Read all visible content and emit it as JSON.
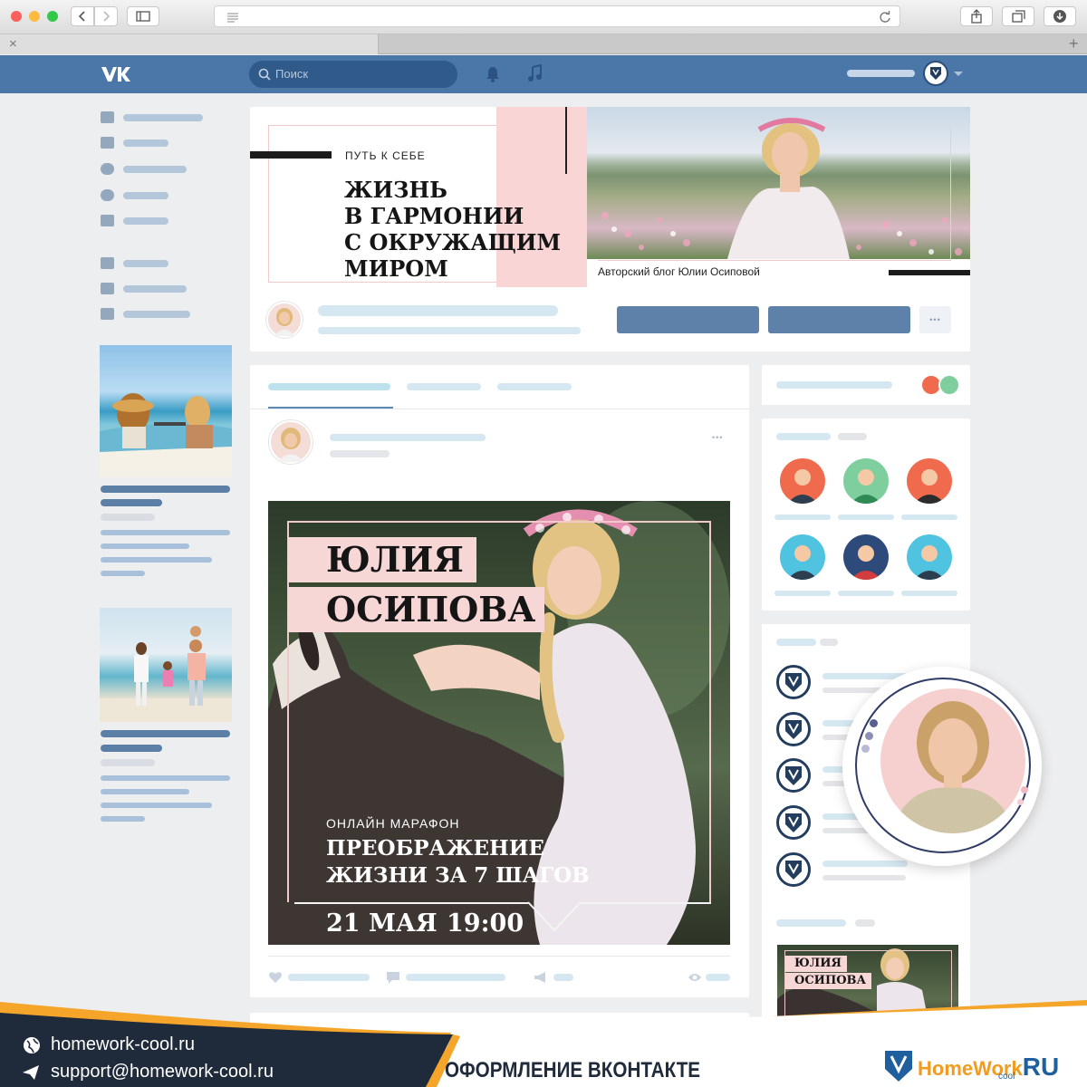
{
  "browser": {
    "tab_close": "×",
    "new_tab": "+"
  },
  "vk": {
    "logo": "VK",
    "search_placeholder": "Поиск",
    "accent": "#4a76a8"
  },
  "cover": {
    "kicker": "ПУТЬ К СЕБЕ",
    "title_lines": [
      "ЖИЗНЬ",
      "В ГАРМОНИИ",
      "С ОКРУЖАЩИМ",
      "МИРОМ"
    ],
    "caption": "Авторский блог Юлии Осиповой",
    "more": "•••"
  },
  "post": {
    "more": "•••",
    "name_lines": [
      "ЮЛИЯ",
      "ОСИПОВА"
    ],
    "kicker": "ОНЛАЙН МАРАФОН",
    "title_lines": [
      "ПРЕОБРАЖЕНИЕ",
      "ЖИЗНИ ЗА 7 ШАГОВ"
    ],
    "date": "21 МАЯ",
    "time": "19:00"
  },
  "sidebar_thumb": {
    "name_lines": [
      "ЮЛИЯ",
      "ОСИПОВА"
    ]
  },
  "footer": {
    "site": "homework-cool.ru",
    "email": "support@homework-cool.ru",
    "tagline": "ОФОРМЛЕНИЕ ВКОНТАКТЕ",
    "brand_a": "HomeWork",
    "brand_b": "RU",
    "brand_c": "cool"
  },
  "icons": [
    "back-icon",
    "forward-icon",
    "sidebar-toggle-icon",
    "reader-icon",
    "reload-icon",
    "share-icon",
    "tabs-icon",
    "download-icon",
    "search-icon",
    "bell-icon",
    "music-icon",
    "home-icon",
    "news-icon",
    "messages-icon",
    "friends-icon",
    "groups-icon",
    "bag-icon",
    "document-icon",
    "games-icon",
    "heart-icon",
    "comment-icon",
    "megaphone-icon",
    "eye-icon",
    "globe-icon",
    "send-icon"
  ]
}
